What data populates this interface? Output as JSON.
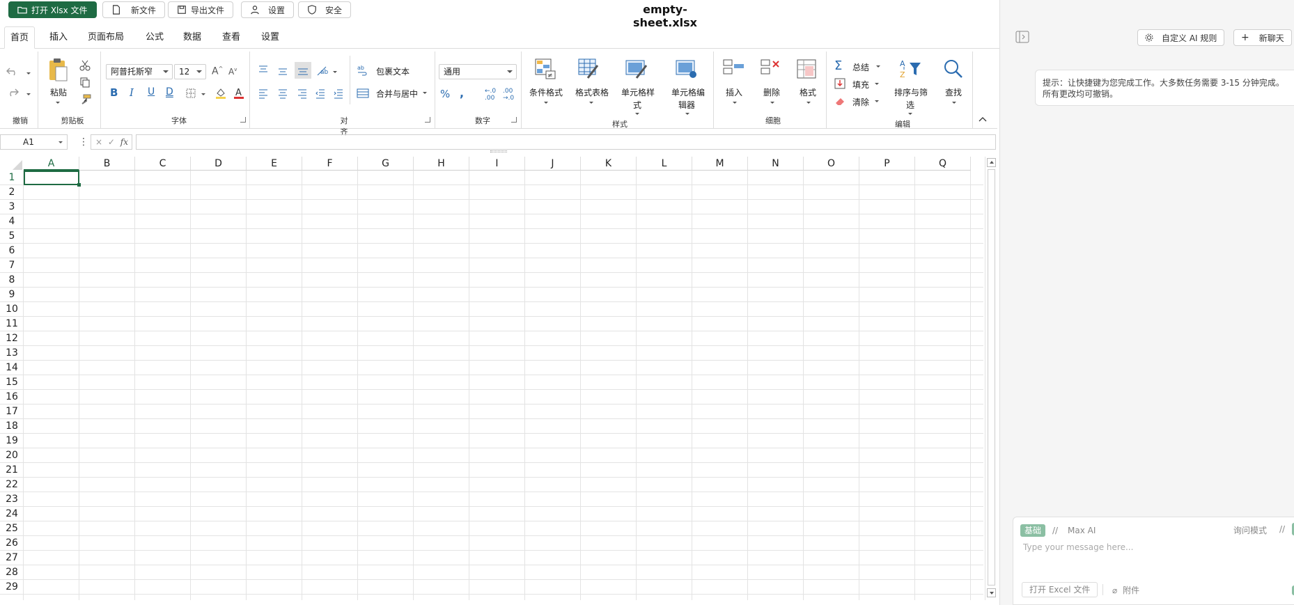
{
  "topbar": {
    "open_btn": "打开 Xlsx 文件",
    "new_btn": "新文件",
    "export_btn": "导出文件",
    "settings_btn": "设置",
    "security_btn": "安全",
    "doc_title": "empty-sheet.xlsx"
  },
  "ribbon_tabs": [
    "首页",
    "插入",
    "页面布局",
    "公式",
    "数据",
    "查看",
    "设置"
  ],
  "ribbon": {
    "undo_group": "撤销",
    "paste": "粘贴",
    "clipboard_group": "剪贴板",
    "font_name": "阿普托斯窄",
    "font_size": "12",
    "font_group": "字体",
    "wrap_text": "包裹文本",
    "merge_center": "合并与居中",
    "align_group": "对齐",
    "number_format": "通用",
    "number_group": "数字",
    "cond_format": "条件格式",
    "format_table": "格式表格",
    "cell_style_1": "单元格样",
    "cell_style_2": "式",
    "cell_editor_1": "单元格编",
    "cell_editor_2": "辑器",
    "styles_group": "样式",
    "insert": "插入",
    "delete": "删除",
    "format": "格式",
    "cells_group": "细胞",
    "sum": "总结",
    "fill": "填充",
    "clear": "清除",
    "sort_filter_1": "排序与筛",
    "sort_filter_2": "选",
    "find": "查找",
    "edit_group": "编辑"
  },
  "formula_bar": {
    "name_box": "A1",
    "fx": "fx"
  },
  "columns": [
    "A",
    "B",
    "C",
    "D",
    "E",
    "F",
    "G",
    "H",
    "I",
    "J",
    "K",
    "L",
    "M",
    "N",
    "O",
    "P",
    "Q"
  ],
  "rows": [
    "1",
    "2",
    "3",
    "4",
    "5",
    "6",
    "7",
    "8",
    "9",
    "10",
    "11",
    "12",
    "13",
    "14",
    "15",
    "16",
    "17",
    "18",
    "19",
    "20",
    "21",
    "22",
    "23",
    "24",
    "25",
    "26",
    "27",
    "28",
    "29"
  ],
  "right_pane": {
    "custom_rules_btn": "自定义 AI 规则",
    "new_chat_btn": "新聊天",
    "hint": "提示：让快捷键为您完成工作。大多数任务需要 3-15 分钟完成。所有更改均可撤销。",
    "mode_basic": "基础",
    "separator": "//",
    "mode_max": "Max AI",
    "ask_mode": "询问模式",
    "message_placeholder": "Type your message here...",
    "open_excel_btn": "打开 Excel 文件",
    "attach_btn": "附件"
  },
  "colors": {
    "accent": "#1e6b43",
    "pill": "#8bbfa3"
  }
}
